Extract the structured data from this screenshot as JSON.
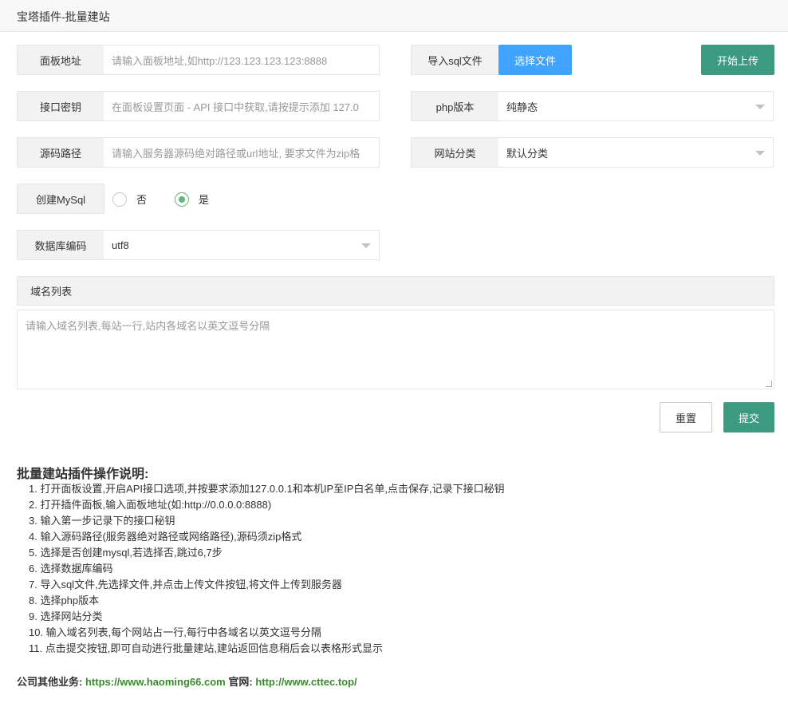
{
  "window": {
    "title": "宝塔插件-批量建站"
  },
  "form": {
    "panel_address": {
      "label": "面板地址",
      "placeholder": "请输入面板地址,如http://123.123.123.123:8888"
    },
    "api_key": {
      "label": "接口密钥",
      "placeholder": "在面板设置页面 - API 接口中获取,请按提示添加 127.0"
    },
    "source_path": {
      "label": "源码路径",
      "placeholder": "请输入服务器源码绝对路径或url地址, 要求文件为zip格"
    },
    "create_mysql": {
      "label": "创建MySql",
      "options": [
        "否",
        "是"
      ],
      "selected": "是"
    },
    "db_charset": {
      "label": "数据库编码",
      "value": "utf8"
    },
    "import_sql": {
      "label": "导入sql文件",
      "button": "选择文件"
    },
    "start_upload": "开始上传",
    "php_version": {
      "label": "php版本",
      "value": "纯静态"
    },
    "site_category": {
      "label": "网站分类",
      "value": "默认分类"
    },
    "domains": {
      "label": "域名列表",
      "placeholder": "请输入域名列表,每站一行,站内各域名以英文逗号分隔"
    },
    "reset": "重置",
    "submit": "提交"
  },
  "help": {
    "title": "批量建站插件操作说明:",
    "items": [
      "1. 打开面板设置,开启API接口选项,并按要求添加127.0.0.1和本机IP至IP白名单,点击保存,记录下接口秘钥",
      "2. 打开插件面板,输入面板地址(如:http://0.0.0.0:8888)",
      "3. 输入第一步记录下的接口秘钥",
      "4. 输入源码路径(服务器绝对路径或网络路径),源码须zip格式",
      "5. 选择是否创建mysql,若选择否,跳过6,7步",
      "6. 选择数据库编码",
      "7. 导入sql文件,先选择文件,并点击上传文件按钮,将文件上传到服务器",
      "8. 选择php版本",
      "9. 选择网站分类",
      "10. 输入域名列表,每个网站占一行,每行中各域名以英文逗号分隔",
      "11. 点击提交按钮,即可自动进行批量建站,建站返回信息稍后会以表格形式显示"
    ]
  },
  "footer": {
    "biz_label": "公司其他业务:",
    "biz_link": "https://www.haoming66.com",
    "site_label": "官网:",
    "site_link": "http://www.cttec.top/"
  },
  "colors": {
    "accent_green": "#3c9a80",
    "accent_blue": "#3ea4ff",
    "link_green": "#3a8a2e",
    "radio_green": "#5fb878"
  }
}
